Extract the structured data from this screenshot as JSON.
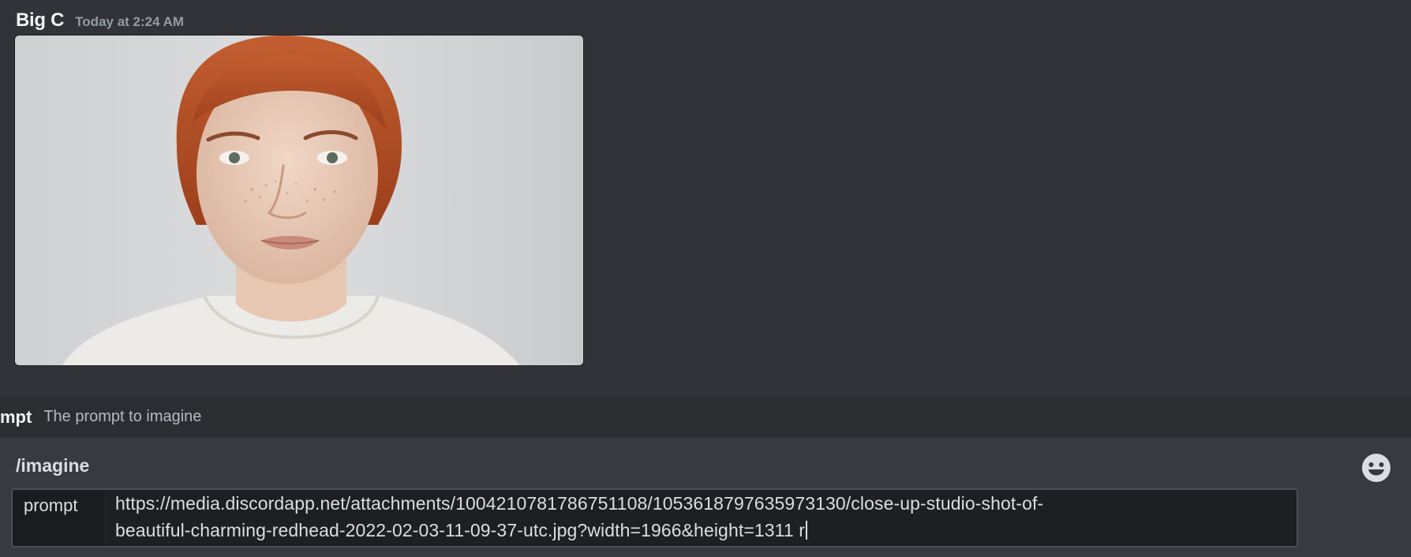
{
  "message": {
    "author": "Big C",
    "timestamp": "Today at 2:24 AM",
    "attachment_icon": "portrait-photo"
  },
  "hint": {
    "option_name": "mpt",
    "option_description": "The prompt to imagine"
  },
  "command": {
    "name": "/imagine",
    "option_label": "prompt",
    "option_value_line1": "https://media.discordapp.net/attachments/1004210781786751108/1053618797635973130/close-up-studio-shot-of-",
    "option_value_line2": "beautiful-charming-redhead-2022-02-03-11-09-37-utc.jpg?width=1966&height=1311 r",
    "emoji_icon": "smiley-face-icon"
  },
  "colors": {
    "background": "#313338",
    "hint_bar": "#2b2d31",
    "command_area": "#383a40",
    "input": "#1e1f22",
    "hair": "#b4532a"
  }
}
